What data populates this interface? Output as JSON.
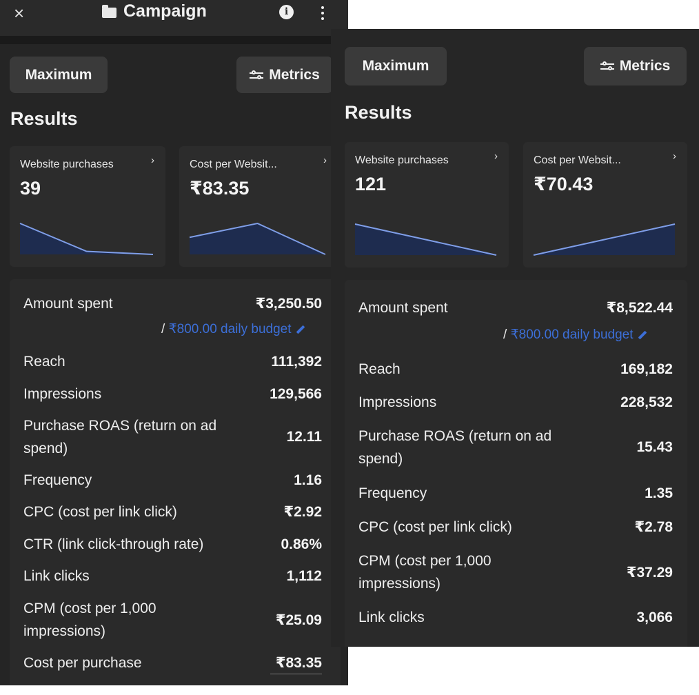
{
  "header": {
    "close": "×",
    "title": "Campaign",
    "info": "i"
  },
  "left": {
    "buttons": {
      "maximum": "Maximum",
      "metrics": "Metrics"
    },
    "section_title": "Results",
    "cards": [
      {
        "label": "Website purchases",
        "value": "39",
        "trend": [
          1.0,
          0.1,
          0.0
        ]
      },
      {
        "label": "Cost per Websit...",
        "value": "₹83.35",
        "trend": [
          0.55,
          1.0,
          0.0
        ]
      }
    ],
    "amount_spent": {
      "label": "Amount spent",
      "value": "₹3,250.50",
      "slash": "/",
      "budget": "₹800.00 daily budget"
    },
    "rows": [
      {
        "label": "Reach",
        "value": "111,392"
      },
      {
        "label": "Impressions",
        "value": "129,566"
      },
      {
        "label": "Purchase ROAS (return on ad spend)",
        "value": "12.11"
      },
      {
        "label": "Frequency",
        "value": "1.16"
      },
      {
        "label": "CPC (cost per link click)",
        "value": "₹2.92"
      },
      {
        "label": "CTR (link click-through rate)",
        "value": "0.86%"
      },
      {
        "label": "Link clicks",
        "value": "1,112"
      },
      {
        "label": "CPM (cost per 1,000 impressions)",
        "value": "₹25.09"
      },
      {
        "label": "Cost per purchase",
        "value": "₹83.35"
      }
    ]
  },
  "right": {
    "buttons": {
      "maximum": "Maximum",
      "metrics": "Metrics"
    },
    "section_title": "Results",
    "cards": [
      {
        "label": "Website purchases",
        "value": "121",
        "trend": [
          1.0,
          0.5,
          0.0
        ]
      },
      {
        "label": "Cost per Websit...",
        "value": "₹70.43",
        "trend": [
          0.0,
          0.5,
          1.0
        ]
      }
    ],
    "amount_spent": {
      "label": "Amount spent",
      "value": "₹8,522.44",
      "slash": "/",
      "budget": "₹800.00 daily budget"
    },
    "rows": [
      {
        "label": "Reach",
        "value": "169,182"
      },
      {
        "label": "Impressions",
        "value": "228,532"
      },
      {
        "label": "Purchase ROAS (return on ad spend)",
        "value": "15.43"
      },
      {
        "label": "Frequency",
        "value": "1.35"
      },
      {
        "label": "CPC (cost per link click)",
        "value": "₹2.78"
      },
      {
        "label": "CPM (cost per 1,000 impressions)",
        "value": "₹37.29"
      },
      {
        "label": "Link clicks",
        "value": "3,066"
      }
    ]
  },
  "colors": {
    "background": "#252525",
    "card": "#2c2c2c",
    "accent_blue": "#3c6fd8",
    "sparkline_line": "#7f9ee8",
    "sparkline_fill": "#1e2c4f"
  }
}
